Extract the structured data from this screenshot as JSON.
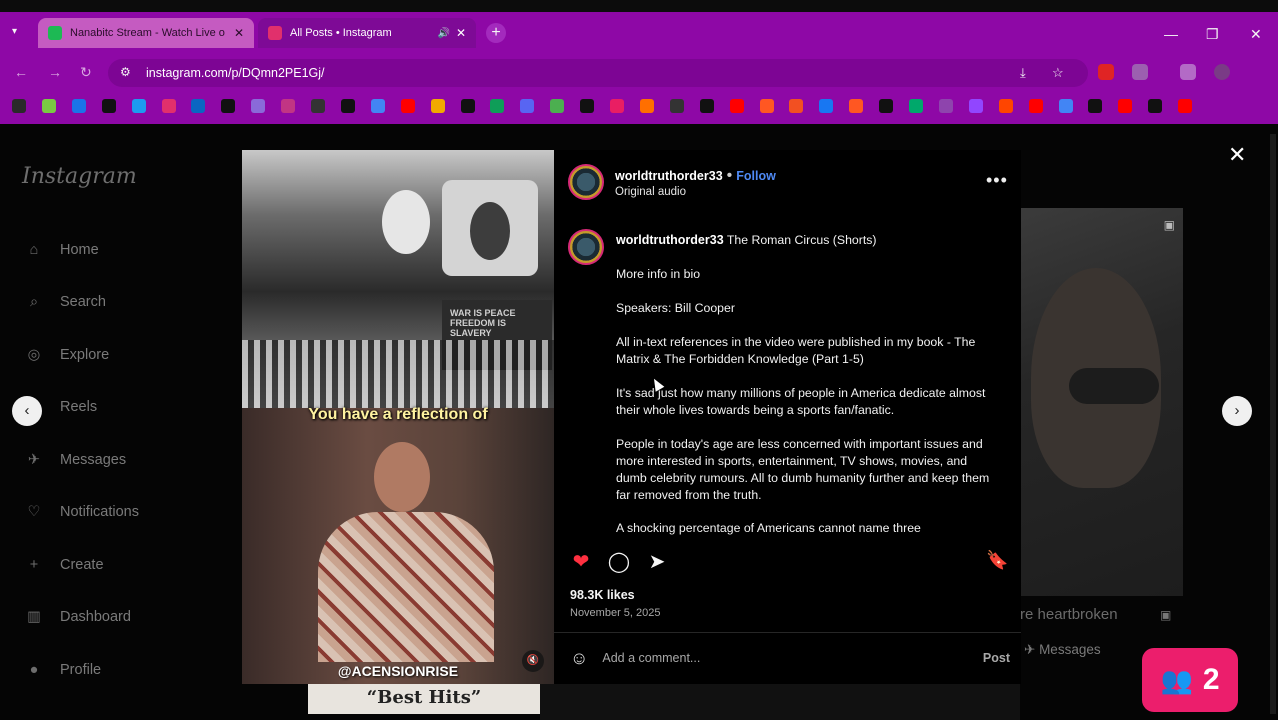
{
  "browser": {
    "tabs": [
      {
        "title": "Nanabitc Stream - Watch Live o",
        "favicon_color": "#1db954",
        "close": "✕"
      },
      {
        "title": "All Posts • Instagram",
        "favicon_color": "#e1306c",
        "close": "✕",
        "audio": "🔊"
      }
    ],
    "tab_menu_caret": "▾",
    "new_tab": "+",
    "window_controls": {
      "minimize": "—",
      "restore": "❐",
      "close": "✕"
    },
    "nav": {
      "back": "←",
      "forward": "→",
      "reload": "↻"
    },
    "url": "instagram.com/p/DQmn2PE1Gj/",
    "site_info_icon": "⚙",
    "right_icons": {
      "install": "⤓",
      "star": "☆"
    },
    "extensions_colors": [
      "#e02424",
      "#9c5fb0",
      "#b36ac6",
      "#7a3b86"
    ],
    "bookmark_colors": [
      "#2a2a2a",
      "#7ac943",
      "#1a74e8",
      "#111",
      "#1d9bf0",
      "#e1306c",
      "#0a66c2",
      "#111",
      "#8a6ad9",
      "#c13584",
      "#333",
      "#111",
      "#4285f4",
      "#ff0000",
      "#f2a900",
      "#111",
      "#0f9d58",
      "#5865f2",
      "#4caf50",
      "#111",
      "#e91e63",
      "#ff6f00",
      "#333",
      "#111",
      "#ff0000",
      "#ff5722",
      "#f25022",
      "#1877f2",
      "#ff5722",
      "#111",
      "#00a86b",
      "#8e44ad",
      "#9146ff",
      "#ff4500",
      "#ff0000",
      "#4285f4",
      "#111",
      "#ff0000",
      "#111",
      "#ff0000"
    ]
  },
  "sidebar": {
    "logo": "Instagram",
    "items": [
      {
        "label": "Home",
        "icon": "⌂"
      },
      {
        "label": "Search",
        "icon": "⌕"
      },
      {
        "label": "Explore",
        "icon": "◎"
      },
      {
        "label": "Reels",
        "icon": "▶"
      },
      {
        "label": "Messages",
        "icon": "✈"
      },
      {
        "label": "Notifications",
        "icon": "♡"
      },
      {
        "label": "Create",
        "icon": "+"
      },
      {
        "label": "Dashboard",
        "icon": "▥"
      },
      {
        "label": "Profile",
        "icon": "●"
      }
    ]
  },
  "modal": {
    "close": "✕",
    "prev": "‹",
    "next": "›"
  },
  "media": {
    "sign_text": "WAR IS PEACE FREEDOM IS SLAVERY",
    "caption": "You have a reflection of",
    "watermark": "@ACENSIONRISE",
    "mute_icon": "🔇"
  },
  "post": {
    "username": "worldtruthorder33",
    "dot": "•",
    "follow": "Follow",
    "audio": "Original audio",
    "more": "•••",
    "caption_title": "The Roman Circus (Shorts)",
    "paragraphs": [
      "More info in bio",
      "Speakers: Bill Cooper",
      "All in-text references in the video were published in my book - The Matrix & The Forbidden Knowledge (Part 1-5)",
      "It's sad just how many millions of people in America dedicate almost their whole lives towards being a sports fan/fanatic.",
      "People in today's age are less concerned with important issues and more interested in sports, entertainment, TV shows, movies, and dumb celebrity rumours. All to dumb humanity further and keep them far removed from the truth.",
      "A shocking percentage of Americans cannot name three"
    ],
    "likes": "98.3K likes",
    "date": "November 5, 2025",
    "comment_placeholder": "Add a comment...",
    "post_button": "Post",
    "heart_color": "#ff3040"
  },
  "background": {
    "partial_text": "re heartbroken",
    "messages_label": "Messages",
    "best_hits": "“Best Hits”"
  },
  "overlay": {
    "count": "2",
    "color": "#ec1e6c"
  }
}
